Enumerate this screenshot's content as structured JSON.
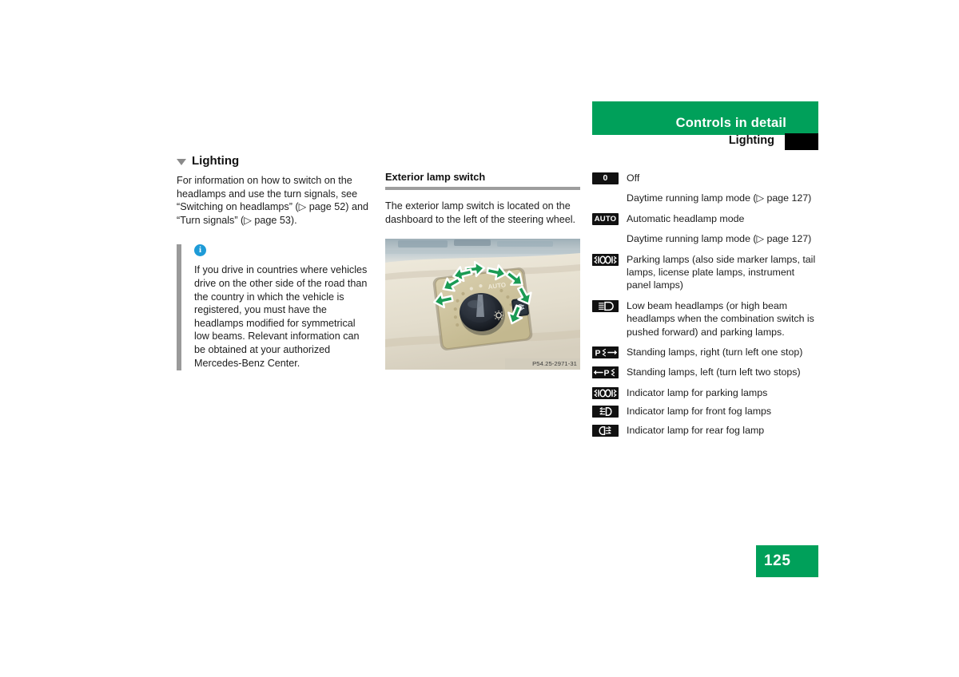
{
  "header": {
    "title": "Controls in detail",
    "subtitle": "Lighting"
  },
  "page_number": "125",
  "left_column": {
    "section_heading": "Lighting",
    "intro_paragraph": "For information on how to switch on the headlamps and use the turn signals, see “Switching on headlamps” (▷ page 52) and “Turn signals” (▷ page 53).",
    "info_box": {
      "icon": "info-icon",
      "text": "If you drive in countries where vehicles drive on the other side of the road than the country in which the vehicle is registered, you must have the headlamps modified for symmetrical low beams. Relevant information can be obtained at your authorized Mercedes-Benz Center."
    }
  },
  "middle_column": {
    "sub_heading": "Exterior lamp switch",
    "paragraph": "The exterior lamp switch is located on the dashboard to the left of the steering wheel.",
    "figure": {
      "alt": "Exterior lamp rotary switch on dashboard with green rotation arrows",
      "caption": "P54.25-2971-31"
    }
  },
  "right_column": {
    "lamp_positions": [
      {
        "badge_type": "text",
        "badge": "0",
        "icon_name": "lamp-off-badge",
        "label": "Off"
      },
      {
        "badge_type": "none",
        "badge": "",
        "icon_name": "no-badge",
        "label": "Daytime running lamp mode (▷ page 127)"
      },
      {
        "badge_type": "text",
        "badge": "AUTO",
        "icon_name": "auto-headlamp-badge",
        "label": "Automatic headlamp mode"
      },
      {
        "badge_type": "none",
        "badge": "",
        "icon_name": "no-badge",
        "label": "Daytime running lamp mode (▷ page 127)"
      },
      {
        "badge_type": "icon",
        "badge": "",
        "icon_name": "parking-lamps-icon",
        "label": "Parking lamps (also side marker lamps, tail lamps, license plate lamps, instrument panel lamps)"
      },
      {
        "badge_type": "icon",
        "badge": "",
        "icon_name": "low-beam-headlamp-icon",
        "label": "Low beam headlamps (or high beam headlamps when the combination switch is pushed forward) and parking lamps."
      },
      {
        "badge_type": "icon",
        "badge": "",
        "icon_name": "standing-lamps-right-icon",
        "label": "Standing lamps, right (turn left one stop)"
      },
      {
        "badge_type": "icon",
        "badge": "",
        "icon_name": "standing-lamps-left-icon",
        "label": "Standing lamps, left (turn left two stops)"
      },
      {
        "badge_type": "icon",
        "badge": "",
        "icon_name": "parking-lamps-indicator-icon",
        "label": "Indicator lamp for parking lamps"
      },
      {
        "badge_type": "icon",
        "badge": "",
        "icon_name": "front-fog-lamp-icon",
        "label": "Indicator lamp for front fog lamps"
      },
      {
        "badge_type": "icon",
        "badge": "",
        "icon_name": "rear-fog-lamp-icon",
        "label": "Indicator lamp for rear fog lamp"
      }
    ]
  },
  "colors": {
    "brand_green": "#00A05A",
    "badge_black": "#111111",
    "info_blue": "#1E9BD7",
    "rule_grey": "#9d9d9d"
  }
}
